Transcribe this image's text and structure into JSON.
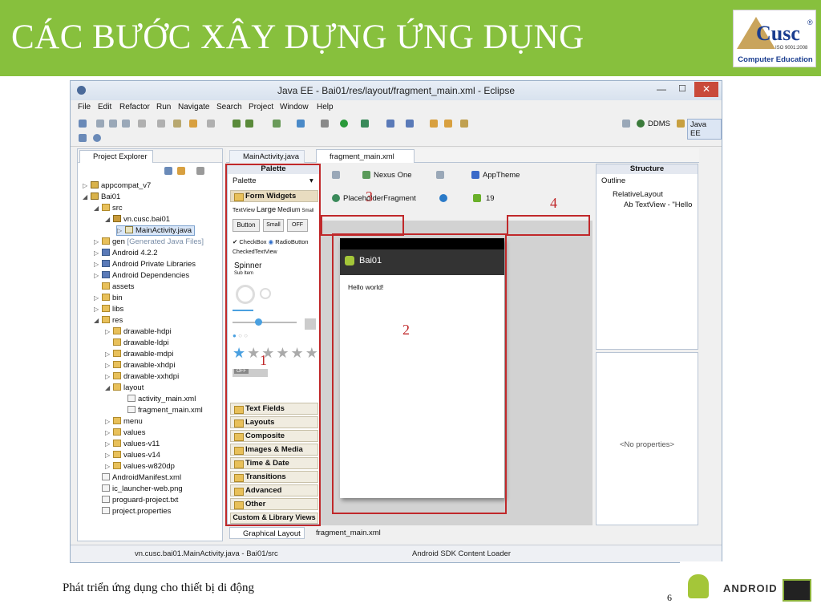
{
  "slide": {
    "title": "CÁC BƯỚC XÂY DỰNG ỨNG DỤNG",
    "logo_text": "Cusc",
    "logo_reg": "®",
    "logo_iso": "ISO 9001:2008",
    "logo_caption": "Computer Education",
    "footer": "Phát triển ứng dụng cho thiết bị di động",
    "page_number": "6",
    "android_logo_text": "ANDROID",
    "colors": {
      "header_green": "#87c03d",
      "annotation_red": "#c0282a"
    }
  },
  "window": {
    "title": "Java EE - Bai01/res/layout/fragment_main.xml - Eclipse",
    "minimize": "—",
    "maximize": "☐",
    "close": "✕"
  },
  "menu": [
    "File",
    "Edit",
    "Refactor",
    "Run",
    "Navigate",
    "Search",
    "Project",
    "Window",
    "Help"
  ],
  "toolbar": {
    "ddms_label": "DDMS",
    "javaee_label": "Java EE"
  },
  "project_explorer": {
    "tab_label": "Project Explorer",
    "rows": [
      "appcompat_v7",
      "Bai01",
      "src",
      "vn.cusc.bai01",
      "MainActivity.java",
      "gen",
      "[Generated Java Files]",
      "Android 4.2.2",
      "Android Private Libraries",
      "Android Dependencies",
      "assets",
      "bin",
      "libs",
      "res",
      "drawable-hdpi",
      "drawable-ldpi",
      "drawable-mdpi",
      "drawable-xhdpi",
      "drawable-xxhdpi",
      "layout",
      "activity_main.xml",
      "fragment_main.xml",
      "menu",
      "values",
      "values-v11",
      "values-v14",
      "values-w820dp",
      "AndroidManifest.xml",
      "ic_launcher-web.png",
      "proguard-project.txt",
      "project.properties"
    ]
  },
  "editor_tabs": {
    "tab1": "MainActivity.java",
    "tab2": "fragment_main.xml"
  },
  "palette": {
    "header": "Palette",
    "palette_label": "Palette",
    "form_widgets": "Form Widgets",
    "textview_row": {
      "tv": "TextView",
      "large": "Large",
      "medium": "Medium",
      "small": "Small"
    },
    "button": "Button",
    "small_button": "Small",
    "toggle_off": "OFF",
    "checkbox": "CheckBox",
    "radio": "RadioButton",
    "checked_textview": "CheckedTextView",
    "spinner": "Spinner",
    "sub_item": "Sub Item",
    "switch_off": "OFF",
    "sections": [
      "Text Fields",
      "Layouts",
      "Composite",
      "Images & Media",
      "Time & Date",
      "Transitions",
      "Advanced",
      "Other"
    ],
    "custom": "Custom & Library Views"
  },
  "layout_toolbar": {
    "device": "Nexus One",
    "theme": "AppTheme",
    "fragment": "PlaceholderFragment",
    "api": "19"
  },
  "device_preview": {
    "app_title": "Bai01",
    "hello": "Hello world!"
  },
  "structure": {
    "header": "Structure",
    "outline": "Outline",
    "relative_layout": "RelativeLayout",
    "textview_item": "Ab TextView - \"Hello",
    "no_properties": "<No properties>"
  },
  "bottom_tabs": {
    "graphical": "Graphical Layout",
    "xml": "fragment_main.xml"
  },
  "statusbar": {
    "path": "vn.cusc.bai01.MainActivity.java - Bai01/src",
    "loader": "Android SDK Content Loader"
  },
  "annotations": {
    "n1": "1",
    "n2": "2",
    "n3": "3",
    "n4": "4"
  }
}
